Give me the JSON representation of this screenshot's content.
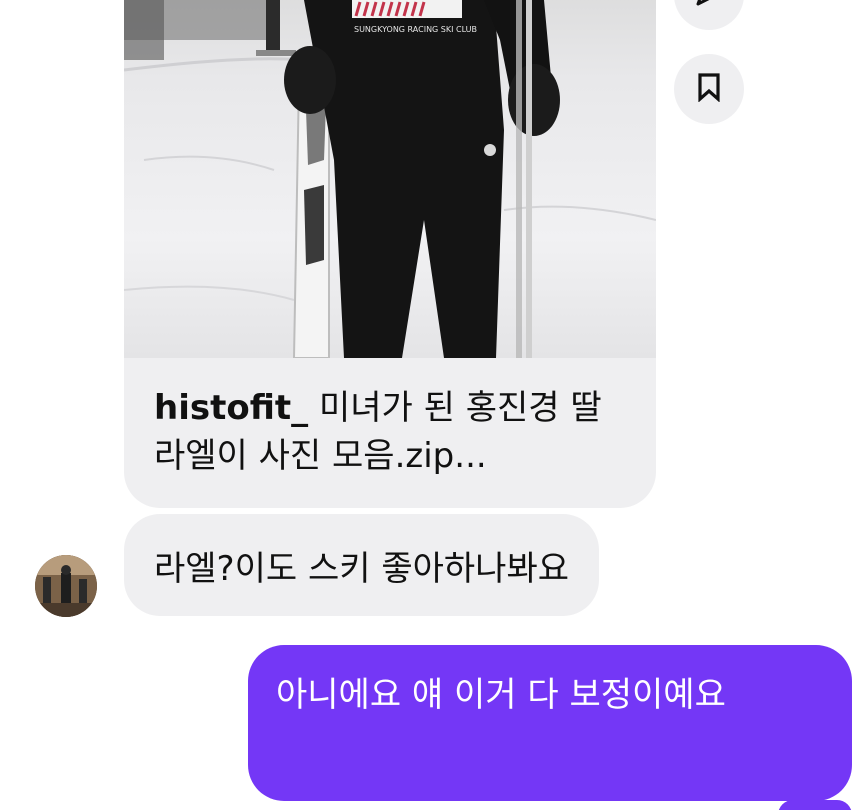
{
  "post": {
    "jacket_text": "SUNGKYONG RACING SKI CLUB",
    "caption_handle": "histofit_",
    "caption_text": " 미녀가 된 홍진경 딸 라엘이 사진 모음.zip..."
  },
  "actions": {
    "share_icon": "send-icon",
    "save_icon": "bookmark-icon"
  },
  "messages": {
    "received_text": "라엘?이도 스키 좋아하나봐요",
    "sent_text": "아니에요 얘 이거 다 보정이예요"
  },
  "colors": {
    "sent_bubble": "#7437f6",
    "received_bubble": "#efeff1"
  }
}
